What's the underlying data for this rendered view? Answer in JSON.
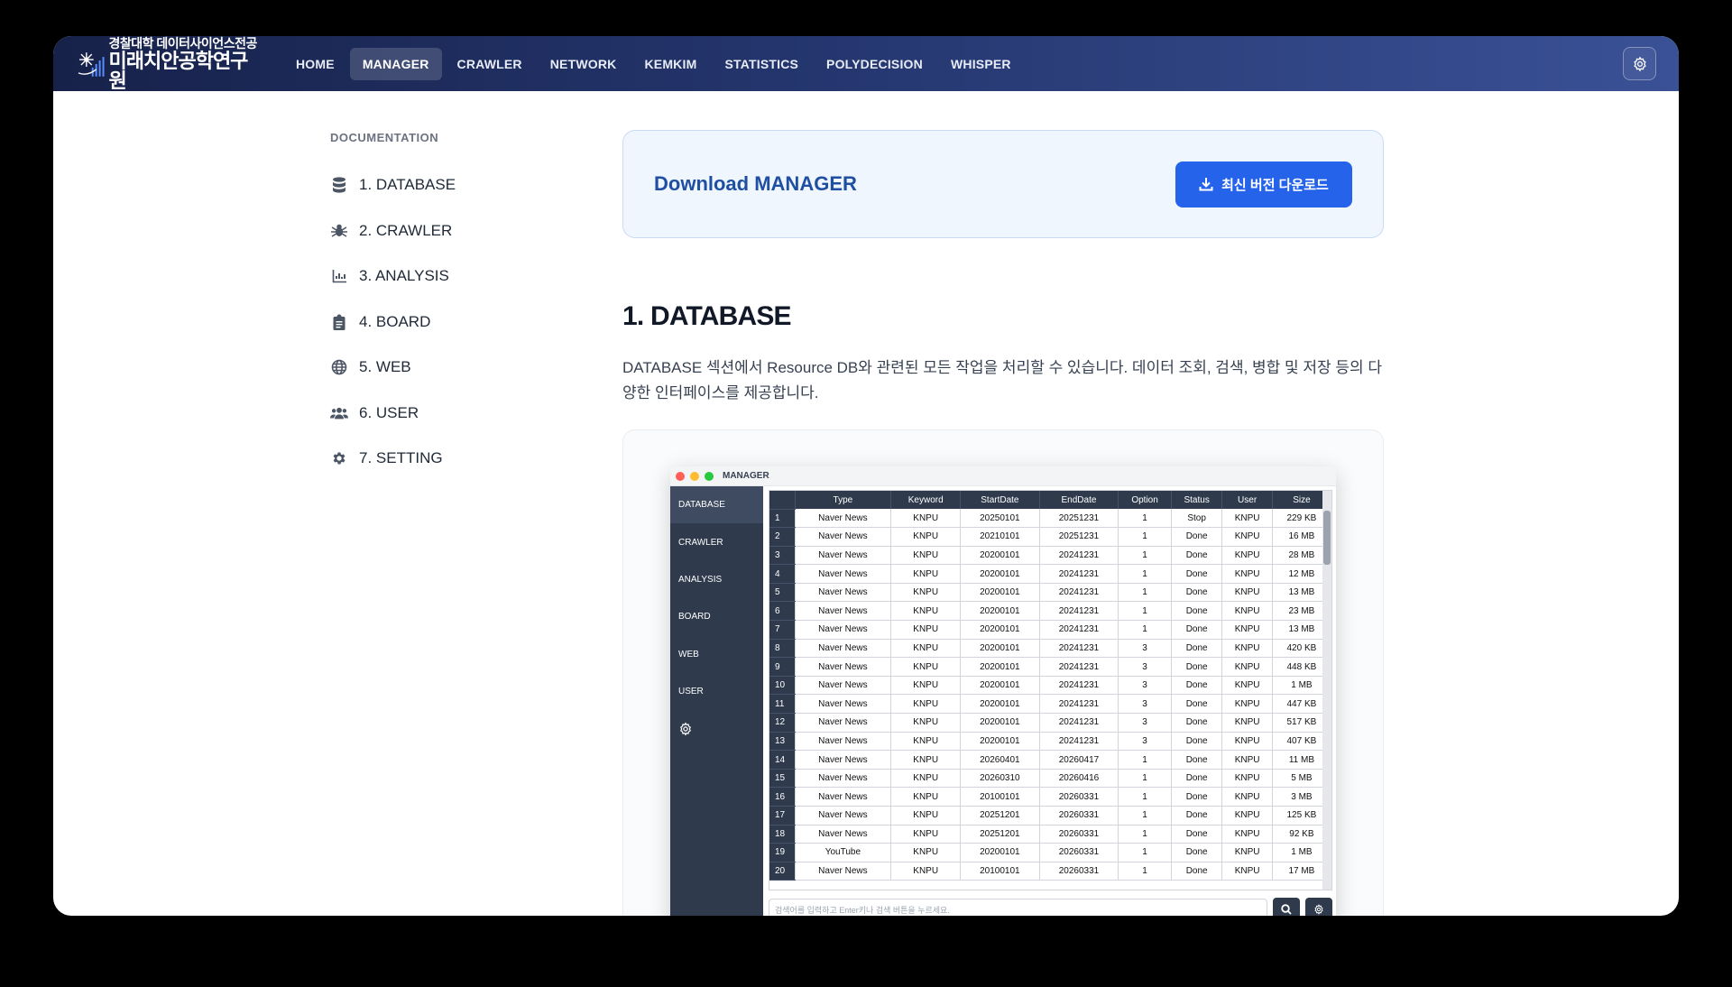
{
  "brand": {
    "sub": "경찰대학 데이터사이언스전공",
    "main": "미래치안공학연구원"
  },
  "nav": {
    "items": [
      {
        "label": "HOME",
        "active": false
      },
      {
        "label": "MANAGER",
        "active": true
      },
      {
        "label": "CRAWLER",
        "active": false
      },
      {
        "label": "NETWORK",
        "active": false
      },
      {
        "label": "KEMKIM",
        "active": false
      },
      {
        "label": "STATISTICS",
        "active": false
      },
      {
        "label": "POLYDECISION",
        "active": false
      },
      {
        "label": "WHISPER",
        "active": false
      }
    ],
    "settings_icon": "gear-icon"
  },
  "sidebar": {
    "title": "DOCUMENTATION",
    "items": [
      {
        "label": "1. DATABASE",
        "icon": "database-icon"
      },
      {
        "label": "2. CRAWLER",
        "icon": "spider-icon"
      },
      {
        "label": "3. ANALYSIS",
        "icon": "chart-icon"
      },
      {
        "label": "4. BOARD",
        "icon": "clipboard-icon"
      },
      {
        "label": "5. WEB",
        "icon": "globe-icon"
      },
      {
        "label": "6. USER",
        "icon": "users-icon"
      },
      {
        "label": "7. SETTING",
        "icon": "gear-icon"
      }
    ]
  },
  "download": {
    "title": "Download MANAGER",
    "button_label": "최신 버전 다운로드"
  },
  "section": {
    "title": "1. DATABASE",
    "description": "DATABASE 섹션에서 Resource DB와 관련된 모든 작업을 처리할 수 있습니다. 데이터 조회, 검색, 병합 및 저장 등의 다양한 인터페이스를 제공합니다."
  },
  "app": {
    "title": "MANAGER",
    "colors": {
      "close": "#ff5f57",
      "min": "#febc2e",
      "max": "#28c840",
      "sidebar": "#2f3b4d"
    },
    "side_items": [
      "DATABASE",
      "CRAWLER",
      "ANALYSIS",
      "BOARD",
      "WEB",
      "USER"
    ],
    "columns": [
      "Type",
      "Keyword",
      "StartDate",
      "EndDate",
      "Option",
      "Status",
      "User",
      "Size"
    ],
    "rows": [
      [
        "1",
        "Naver News",
        "KNPU",
        "20250101",
        "20251231",
        "1",
        "Stop",
        "KNPU",
        "229 KB"
      ],
      [
        "2",
        "Naver News",
        "KNPU",
        "20210101",
        "20251231",
        "1",
        "Done",
        "KNPU",
        "16 MB"
      ],
      [
        "3",
        "Naver News",
        "KNPU",
        "20200101",
        "20241231",
        "1",
        "Done",
        "KNPU",
        "28 MB"
      ],
      [
        "4",
        "Naver News",
        "KNPU",
        "20200101",
        "20241231",
        "1",
        "Done",
        "KNPU",
        "12 MB"
      ],
      [
        "5",
        "Naver News",
        "KNPU",
        "20200101",
        "20241231",
        "1",
        "Done",
        "KNPU",
        "13 MB"
      ],
      [
        "6",
        "Naver News",
        "KNPU",
        "20200101",
        "20241231",
        "1",
        "Done",
        "KNPU",
        "23 MB"
      ],
      [
        "7",
        "Naver News",
        "KNPU",
        "20200101",
        "20241231",
        "1",
        "Done",
        "KNPU",
        "13 MB"
      ],
      [
        "8",
        "Naver News",
        "KNPU",
        "20200101",
        "20241231",
        "3",
        "Done",
        "KNPU",
        "420 KB"
      ],
      [
        "9",
        "Naver News",
        "KNPU",
        "20200101",
        "20241231",
        "3",
        "Done",
        "KNPU",
        "448 KB"
      ],
      [
        "10",
        "Naver News",
        "KNPU",
        "20200101",
        "20241231",
        "3",
        "Done",
        "KNPU",
        "1 MB"
      ],
      [
        "11",
        "Naver News",
        "KNPU",
        "20200101",
        "20241231",
        "3",
        "Done",
        "KNPU",
        "447 KB"
      ],
      [
        "12",
        "Naver News",
        "KNPU",
        "20200101",
        "20241231",
        "3",
        "Done",
        "KNPU",
        "517 KB"
      ],
      [
        "13",
        "Naver News",
        "KNPU",
        "20200101",
        "20241231",
        "3",
        "Done",
        "KNPU",
        "407 KB"
      ],
      [
        "14",
        "Naver News",
        "KNPU",
        "20260401",
        "20260417",
        "1",
        "Done",
        "KNPU",
        "11 MB"
      ],
      [
        "15",
        "Naver News",
        "KNPU",
        "20260310",
        "20260416",
        "1",
        "Done",
        "KNPU",
        "5 MB"
      ],
      [
        "16",
        "Naver News",
        "KNPU",
        "20100101",
        "20260331",
        "1",
        "Done",
        "KNPU",
        "3 MB"
      ],
      [
        "17",
        "Naver News",
        "KNPU",
        "20251201",
        "20260331",
        "1",
        "Done",
        "KNPU",
        "125 KB"
      ],
      [
        "18",
        "Naver News",
        "KNPU",
        "20251201",
        "20260331",
        "1",
        "Done",
        "KNPU",
        "92 KB"
      ],
      [
        "19",
        "YouTube",
        "KNPU",
        "20200101",
        "20260331",
        "1",
        "Done",
        "KNPU",
        "1 MB"
      ],
      [
        "20",
        "Naver News",
        "KNPU",
        "20100101",
        "20260331",
        "1",
        "Done",
        "KNPU",
        "17 MB"
      ]
    ],
    "search_placeholder": "검색어를 입력하고 Enter키나 검색 버튼을 누르세요."
  }
}
